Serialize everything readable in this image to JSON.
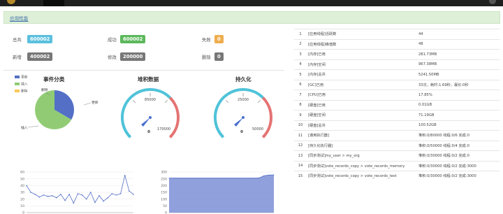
{
  "header": {
    "section_title": "应用性能"
  },
  "stats": [
    {
      "label": "总共",
      "value": "600002",
      "color": "#5bc0de"
    },
    {
      "label": "成功",
      "value": "600002",
      "color": "#5cb85c"
    },
    {
      "label": "失败",
      "value": "0",
      "color": "#f0ad4e"
    },
    {
      "label": "新增",
      "value": "400002",
      "color": "#777777"
    },
    {
      "label": "修改",
      "value": "200000",
      "color": "#777777"
    },
    {
      "label": "删除",
      "value": "0",
      "color": "#777777"
    }
  ],
  "pie": {
    "title": "事件分类",
    "legend": [
      {
        "name": "更新",
        "color": "#5470c6"
      },
      {
        "name": "插入",
        "color": "#91cc75"
      },
      {
        "name": "删除",
        "color": "#fac858"
      }
    ],
    "slice_labels": {
      "update": "更新",
      "insert": "插入",
      "delete": "删除"
    },
    "values": {
      "update": 200000,
      "insert": 400002,
      "delete": 0
    }
  },
  "gauges": [
    {
      "title": "堆积数据",
      "mid_tick": "85000",
      "max_tick": "170000",
      "value": "0",
      "min_tick": "0"
    },
    {
      "title": "持久化",
      "mid_tick": "25000",
      "max_tick": "50000",
      "value": "0",
      "min_tick": "0"
    }
  ],
  "chart_data": [
    {
      "type": "line",
      "ylim": [
        0,
        60
      ],
      "yticks": [
        "60",
        "50",
        "40",
        "30",
        "20",
        "10",
        "0"
      ],
      "series": [
        {
          "values": [
            40,
            30,
            27,
            23,
            26,
            24,
            25,
            22,
            27,
            18,
            27,
            14,
            28,
            26,
            20,
            30,
            15,
            25,
            17,
            22,
            28,
            26,
            28,
            55,
            32,
            27
          ]
        }
      ]
    },
    {
      "type": "area",
      "ylim": [
        0,
        300
      ],
      "yticks": [
        "300",
        "250",
        "200",
        "150",
        "100",
        "50",
        "0"
      ],
      "series": [
        {
          "values": [
            255,
            255,
            255,
            255,
            255,
            255,
            255,
            255,
            255,
            255,
            255,
            255,
            255,
            255,
            255,
            255,
            255,
            255,
            255,
            255,
            255,
            255,
            255,
            255,
            255,
            255,
            255,
            255,
            255,
            255,
            255,
            255,
            255,
            255,
            255,
            255,
            255,
            255,
            255,
            255,
            255,
            255,
            257,
            262,
            270,
            274,
            276,
            278,
            278,
            279
          ]
        }
      ]
    }
  ],
  "info_table": [
    {
      "n": "1",
      "name": "[应用线程]活跃数",
      "value": "44"
    },
    {
      "n": "2",
      "name": "[应用线程]峰值数",
      "value": "48"
    },
    {
      "n": "3",
      "name": "[内存]已用",
      "value": "281.73MB"
    },
    {
      "n": "4",
      "name": "[内存]空闲",
      "value": "967.38MB"
    },
    {
      "n": "5",
      "name": "[内存]总共",
      "value": "5241.50MB"
    },
    {
      "n": "6",
      "name": "[GC]已用",
      "value": "33次，耗时:1.69秒，最长:0秒"
    },
    {
      "n": "7",
      "name": "[CPU]已用",
      "value": "17.85%"
    },
    {
      "n": "8",
      "name": "[硬盘]已用",
      "value": "0.01GB"
    },
    {
      "n": "9",
      "name": "[硬盘]空闲",
      "value": "71.19GB"
    },
    {
      "n": "10",
      "name": "[硬盘]总共",
      "value": "100.52GB"
    },
    {
      "n": "11",
      "name": "[通用执行器]",
      "value": "堆积:0/80000 线程:0/6 完成:0"
    },
    {
      "n": "12",
      "name": "[持久化执行器]",
      "value": "堆积:0/50000 线程:0/4 完成:0"
    },
    {
      "n": "13",
      "name": "[同步测试]my_user > my_org",
      "value": "堆积:0/30000 线程:0/2 完成:0"
    },
    {
      "n": "14",
      "name": "[同步测试]vote_records_copy > vote_records_memory",
      "value": "堆积:0/30000 线程:0/2 完成:3000"
    },
    {
      "n": "15",
      "name": "[同步测试]vote_records_copy > vote_records_test",
      "value": "堆积:0/30000 线程:0/2 完成:3000"
    }
  ]
}
